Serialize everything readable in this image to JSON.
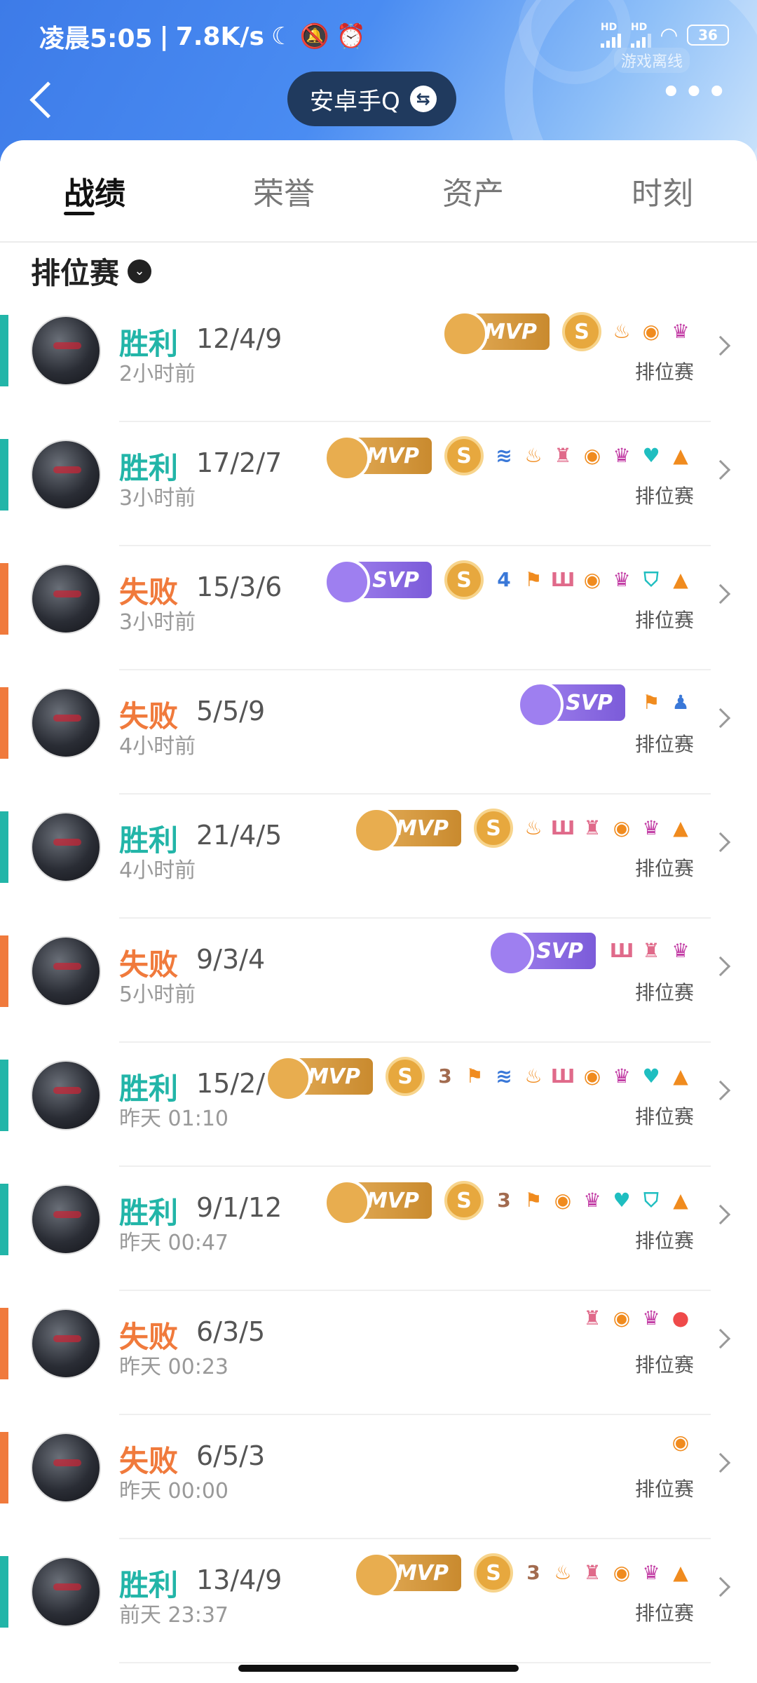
{
  "status_bar": {
    "time": "凌晨5:05",
    "speed": "7.8K/s",
    "moon_icon": "moon-icon",
    "mute_icon": "bell-off-icon",
    "alarm_icon": "alarm-icon",
    "hd1": "HD",
    "hd2": "HD",
    "battery": "36",
    "offline_note": "游戏离线"
  },
  "header": {
    "account": "安卓手Q",
    "swap_icon": "⇆",
    "more": "•••"
  },
  "tabs": [
    {
      "label": "战绩",
      "active": true
    },
    {
      "label": "荣誉",
      "active": false
    },
    {
      "label": "资产",
      "active": false
    },
    {
      "label": "时刻",
      "active": false
    }
  ],
  "filter": {
    "label": "排位赛",
    "caret": "⌄"
  },
  "labels": {
    "mvp": "MVP",
    "svp": "SVP",
    "s_coin": "S"
  },
  "matches": [
    {
      "result": "胜利",
      "outcome": "win",
      "kda": "12/4/9",
      "time": "2小时前",
      "mode": "排位赛",
      "award": "mvp",
      "s_coin": true,
      "icons": [
        {
          "g": "♨",
          "c": "orange",
          "n": "fire-icon"
        },
        {
          "g": "◉",
          "c": "orange",
          "n": "coins-icon"
        },
        {
          "g": "♛",
          "c": "purple",
          "n": "demon-icon"
        }
      ]
    },
    {
      "result": "胜利",
      "outcome": "win",
      "kda": "17/2/7",
      "time": "3小时前",
      "mode": "排位赛",
      "award": "mvp",
      "s_coin": true,
      "icons": [
        {
          "g": "≋",
          "c": "blue",
          "n": "wave-icon"
        },
        {
          "g": "♨",
          "c": "orange",
          "n": "fire-icon"
        },
        {
          "g": "♜",
          "c": "pink",
          "n": "tower-icon"
        },
        {
          "g": "◉",
          "c": "orange",
          "n": "coins-icon"
        },
        {
          "g": "♛",
          "c": "purple",
          "n": "demon-icon"
        },
        {
          "g": "♥",
          "c": "teal",
          "n": "heal-icon"
        },
        {
          "g": "▲",
          "c": "orange",
          "n": "coins-up-icon"
        }
      ]
    },
    {
      "result": "失败",
      "outcome": "lose",
      "kda": "15/3/6",
      "time": "3小时前",
      "mode": "排位赛",
      "award": "svp",
      "s_coin": true,
      "icons": [
        {
          "g": "4",
          "c": "blue",
          "n": "streak-4-icon"
        },
        {
          "g": "⚑",
          "c": "orange",
          "n": "flag-icon"
        },
        {
          "g": "Ш",
          "c": "pink",
          "n": "crown-icon"
        },
        {
          "g": "◉",
          "c": "orange",
          "n": "coins-icon"
        },
        {
          "g": "♛",
          "c": "purple",
          "n": "demon-icon"
        },
        {
          "g": "⛉",
          "c": "teal",
          "n": "shield-icon"
        },
        {
          "g": "▲",
          "c": "orange",
          "n": "coins-up-icon"
        }
      ]
    },
    {
      "result": "失败",
      "outcome": "lose",
      "kda": "5/5/9",
      "time": "4小时前",
      "mode": "排位赛",
      "award": "svp",
      "s_coin": false,
      "icons": [
        {
          "g": "⚑",
          "c": "orange",
          "n": "flag-icon"
        },
        {
          "g": "♟",
          "c": "blue",
          "n": "player-icon"
        }
      ]
    },
    {
      "result": "胜利",
      "outcome": "win",
      "kda": "21/4/5",
      "time": "4小时前",
      "mode": "排位赛",
      "award": "mvp",
      "s_coin": true,
      "icons": [
        {
          "g": "♨",
          "c": "orange",
          "n": "fire-icon"
        },
        {
          "g": "Ш",
          "c": "pink",
          "n": "crown-icon"
        },
        {
          "g": "♜",
          "c": "pink",
          "n": "tower-icon"
        },
        {
          "g": "◉",
          "c": "orange",
          "n": "coins-icon"
        },
        {
          "g": "♛",
          "c": "purple",
          "n": "demon-icon"
        },
        {
          "g": "▲",
          "c": "orange",
          "n": "coins-up-icon"
        }
      ]
    },
    {
      "result": "失败",
      "outcome": "lose",
      "kda": "9/3/4",
      "time": "5小时前",
      "mode": "排位赛",
      "award": "svp",
      "s_coin": false,
      "icons": [
        {
          "g": "Ш",
          "c": "pink",
          "n": "crown-icon"
        },
        {
          "g": "♜",
          "c": "pink",
          "n": "tower-icon"
        },
        {
          "g": "♛",
          "c": "purple",
          "n": "demon-icon"
        }
      ]
    },
    {
      "result": "胜利",
      "outcome": "win",
      "kda": "15/2/",
      "time": "昨天 01:10",
      "mode": "排位赛",
      "award": "mvp",
      "s_coin": true,
      "icons": [
        {
          "g": "3",
          "c": "brown",
          "n": "streak-3-icon"
        },
        {
          "g": "⚑",
          "c": "orange",
          "n": "flag-icon"
        },
        {
          "g": "≋",
          "c": "blue",
          "n": "wave-icon"
        },
        {
          "g": "♨",
          "c": "orange",
          "n": "fire-icon"
        },
        {
          "g": "Ш",
          "c": "pink",
          "n": "crown-icon"
        },
        {
          "g": "◉",
          "c": "orange",
          "n": "coins-icon"
        },
        {
          "g": "♛",
          "c": "purple",
          "n": "demon-icon"
        },
        {
          "g": "♥",
          "c": "teal",
          "n": "heal-icon"
        },
        {
          "g": "▲",
          "c": "orange",
          "n": "coins-up-icon"
        }
      ]
    },
    {
      "result": "胜利",
      "outcome": "win",
      "kda": "9/1/12",
      "time": "昨天 00:47",
      "mode": "排位赛",
      "award": "mvp",
      "s_coin": true,
      "icons": [
        {
          "g": "3",
          "c": "brown",
          "n": "streak-3-icon"
        },
        {
          "g": "⚑",
          "c": "orange",
          "n": "flag-icon"
        },
        {
          "g": "◉",
          "c": "orange",
          "n": "coins-icon"
        },
        {
          "g": "♛",
          "c": "purple",
          "n": "demon-icon"
        },
        {
          "g": "♥",
          "c": "teal",
          "n": "heal-icon"
        },
        {
          "g": "⛉",
          "c": "teal",
          "n": "shield-icon"
        },
        {
          "g": "▲",
          "c": "orange",
          "n": "coins-up-icon"
        }
      ]
    },
    {
      "result": "失败",
      "outcome": "lose",
      "kda": "6/3/5",
      "time": "昨天 00:23",
      "mode": "排位赛",
      "award": "none",
      "s_coin": false,
      "icons": [
        {
          "g": "♜",
          "c": "pink",
          "n": "tower-icon"
        },
        {
          "g": "◉",
          "c": "orange",
          "n": "coins-icon"
        },
        {
          "g": "♛",
          "c": "purple",
          "n": "demon-icon"
        },
        {
          "g": "●",
          "c": "red",
          "n": "blood-drop-icon"
        }
      ]
    },
    {
      "result": "失败",
      "outcome": "lose",
      "kda": "6/5/3",
      "time": "昨天 00:00",
      "mode": "排位赛",
      "award": "none",
      "s_coin": false,
      "icons": [
        {
          "g": "◉",
          "c": "orange",
          "n": "coins-icon"
        }
      ]
    },
    {
      "result": "胜利",
      "outcome": "win",
      "kda": "13/4/9",
      "time": "前天 23:37",
      "mode": "排位赛",
      "award": "mvp",
      "s_coin": true,
      "icons": [
        {
          "g": "3",
          "c": "brown",
          "n": "streak-3-icon"
        },
        {
          "g": "♨",
          "c": "orange",
          "n": "fire-icon"
        },
        {
          "g": "♜",
          "c": "pink",
          "n": "tower-icon"
        },
        {
          "g": "◉",
          "c": "orange",
          "n": "coins-icon"
        },
        {
          "g": "♛",
          "c": "purple",
          "n": "demon-icon"
        },
        {
          "g": "▲",
          "c": "orange",
          "n": "coins-up-icon"
        }
      ]
    }
  ]
}
